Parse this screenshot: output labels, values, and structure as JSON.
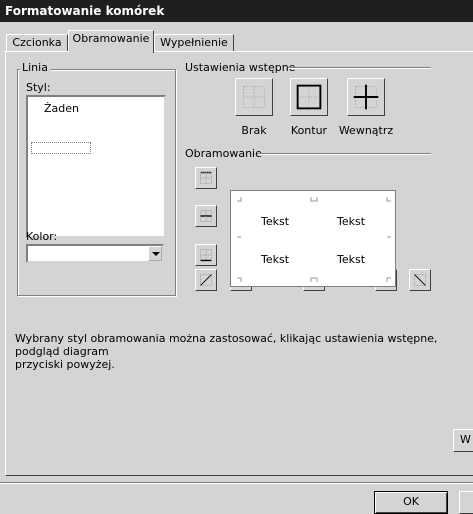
{
  "window": {
    "title": "Formatowanie komórek"
  },
  "tabs": [
    {
      "label": "Czcionka"
    },
    {
      "label": "Obramowanie"
    },
    {
      "label": "Wypełnienie"
    }
  ],
  "line_group": {
    "label": "Linia",
    "style_label": "Styl:",
    "style_list": [
      "Żaden"
    ],
    "color_label": "Kolor:",
    "color_value": ""
  },
  "presets": {
    "label": "Ustawienia wstępne",
    "buttons": [
      {
        "label": "Brak",
        "icon": "border-none-icon"
      },
      {
        "label": "Kontur",
        "icon": "border-outline-icon"
      },
      {
        "label": "Wewnątrz",
        "icon": "border-inside-icon"
      }
    ]
  },
  "border": {
    "label": "Obramowanie",
    "preview_texts": [
      "Tekst",
      "Tekst",
      "Tekst",
      "Tekst"
    ]
  },
  "description": "Wybrany styl obramowania można zastosować, klikając ustawienia wstępne, podgląd diagram\nprzyciski powyżej.",
  "footer": {
    "ok_label": "OK",
    "partial_right_label": "W"
  }
}
